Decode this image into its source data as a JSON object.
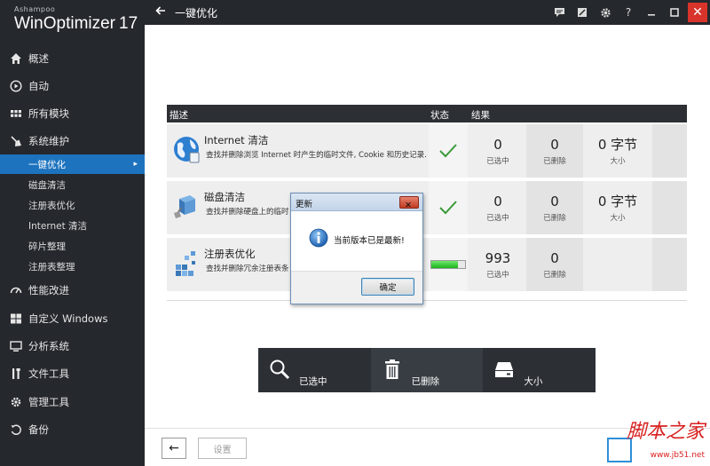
{
  "brand": {
    "vendor": "Ashampoo",
    "product": "WinOptimizer",
    "version": "17"
  },
  "topbar": {
    "title": "一键优化",
    "icons": [
      "feedback-icon",
      "edit-icon",
      "gear-icon",
      "help-icon",
      "minimize-icon",
      "maximize-icon",
      "close-icon"
    ],
    "help_glyph": "?",
    "close_glyph": "✕"
  },
  "sidebar": {
    "items": [
      {
        "label": "概述",
        "icon": "home-icon"
      },
      {
        "label": "自动",
        "icon": "play-icon"
      },
      {
        "label": "所有模块",
        "icon": "grid-icon"
      },
      {
        "label": "系统维护",
        "icon": "broom-icon"
      },
      {
        "label": "性能改进",
        "icon": "gauge-icon"
      },
      {
        "label": "自定义 Windows",
        "icon": "windows-icon"
      },
      {
        "label": "分析系统",
        "icon": "monitor-icon"
      },
      {
        "label": "文件工具",
        "icon": "tools-icon"
      },
      {
        "label": "管理工具",
        "icon": "gear-icon"
      },
      {
        "label": "备份",
        "icon": "restore-icon"
      }
    ],
    "sub_items": [
      {
        "label": "一键优化",
        "active": true,
        "arrow": "▸"
      },
      {
        "label": "磁盘清洁"
      },
      {
        "label": "注册表优化"
      },
      {
        "label": "Internet 清洁"
      },
      {
        "label": "碎片整理"
      },
      {
        "label": "注册表整理"
      }
    ]
  },
  "table": {
    "headers": {
      "desc": "描述",
      "status": "状态",
      "result": "结果"
    },
    "rows": [
      {
        "title": "Internet 清洁",
        "desc": "查找并删除浏览 Internet 时产生的临时文件, Cookie 和历史记录.",
        "status": "done",
        "selected": "0",
        "selected_label": "已选中",
        "deleted": "0",
        "deleted_label": "已删除",
        "size": "0 字节",
        "size_label": "大小"
      },
      {
        "title": "磁盘清洁",
        "desc": "查找并删除硬盘上的临时",
        "status": "done",
        "selected": "0",
        "selected_label": "已选中",
        "deleted": "0",
        "deleted_label": "已删除",
        "size": "0 字节",
        "size_label": "大小"
      },
      {
        "title": "注册表优化",
        "desc": "查找并删除冗余注册表条",
        "status": "running",
        "progress": 0.8,
        "selected": "993",
        "selected_label": "已选中",
        "deleted": "0",
        "deleted_label": "已删除"
      }
    ]
  },
  "summary": {
    "selected_label": "已选中",
    "deleted_label": "已删除",
    "size_label": "大小"
  },
  "bottom": {
    "back_glyph": "←",
    "settings_label": "设置"
  },
  "dialog": {
    "title": "更新",
    "message": "当前版本已是最新!",
    "ok_label": "确定",
    "close_glyph": "✕"
  },
  "watermark": {
    "text": "脚本之家",
    "url": "www.jb51.net"
  },
  "colors": {
    "sidebar_bg": "#25282d",
    "accent": "#1e73be",
    "check": "#3a9a3a",
    "close_red": "#d9342b"
  }
}
